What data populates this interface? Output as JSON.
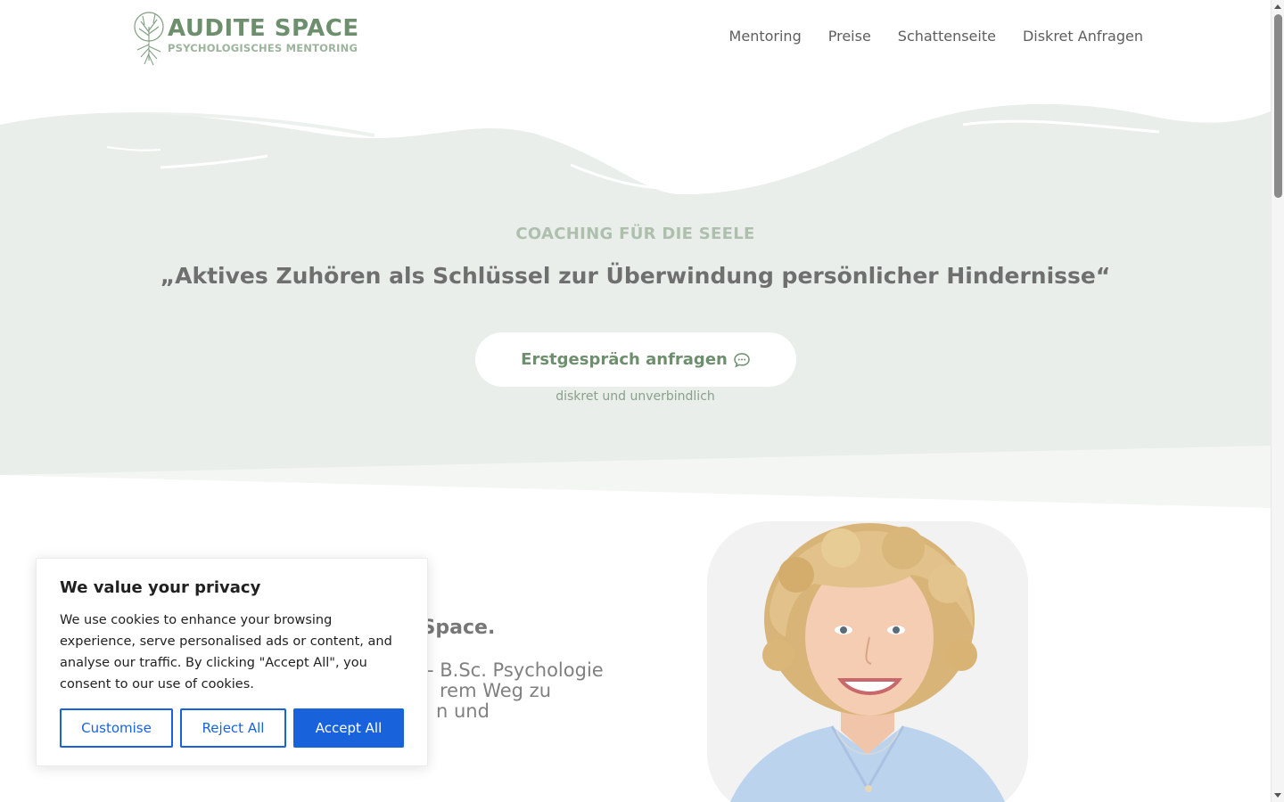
{
  "header": {
    "logo_title": "AUDITE SPACE",
    "logo_subtitle": "PSYCHOLOGISCHES MENTORING",
    "nav": [
      "Mentoring",
      "Preise",
      "Schattenseite",
      "Diskret Anfragen"
    ]
  },
  "hero": {
    "eyebrow": "COACHING FÜR DIE SEELE",
    "headline": "„Aktives Zuhören als Schlüssel zur Überwindung persönlicher Hindernisse“",
    "cta_label": "Erstgespräch anfragen",
    "cta_note": "diskret und unverbindlich"
  },
  "about": {
    "heading_visible": "e Space.",
    "text_line1": "- B.Sc. Psychologie",
    "text_line2": "rem Weg zu",
    "text_line3": "n und"
  },
  "cookie_banner": {
    "title": "We value your privacy",
    "body": "We use cookies to enhance your browsing experience, serve personalised ads or content, and analyse our traffic. By clicking \"Accept All\", you consent to our use of cookies.",
    "customise_label": "Customise",
    "reject_label": "Reject All",
    "accept_label": "Accept All"
  },
  "colors": {
    "brand_green": "#6e8f6e",
    "hero_background": "#e9eeea",
    "cookie_accent": "#1863dc"
  }
}
